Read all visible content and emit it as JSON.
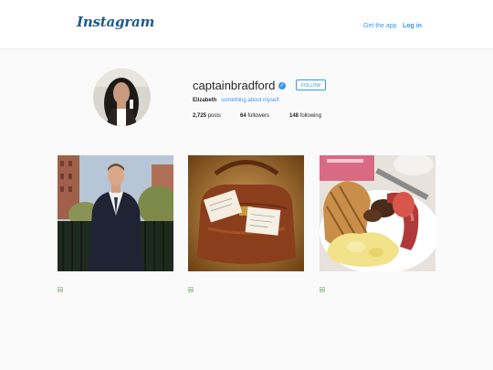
{
  "header": {
    "logo": "Instagram",
    "get_app": "Get the app",
    "log_in": "Log in"
  },
  "profile": {
    "username": "captainbradford",
    "verified_icon": "verified-badge-icon",
    "follow_label": "FOLLOW",
    "full_name": "Elizabeth",
    "bio": "something about myself.",
    "stats": {
      "posts_count": "2,725",
      "posts_label": "posts",
      "followers_count": "64",
      "followers_label": "followers",
      "following_count": "148",
      "following_label": "following"
    }
  },
  "posts": [
    {
      "description": "man in suit"
    },
    {
      "description": "leather bag with notes"
    },
    {
      "description": "breakfast plate"
    }
  ],
  "broken_images": [
    "broken-image-icon",
    "broken-image-icon",
    "broken-image-icon"
  ],
  "colors": {
    "accent": "#3897f0",
    "logo": "#1f5a8a",
    "background": "#fafafa"
  }
}
